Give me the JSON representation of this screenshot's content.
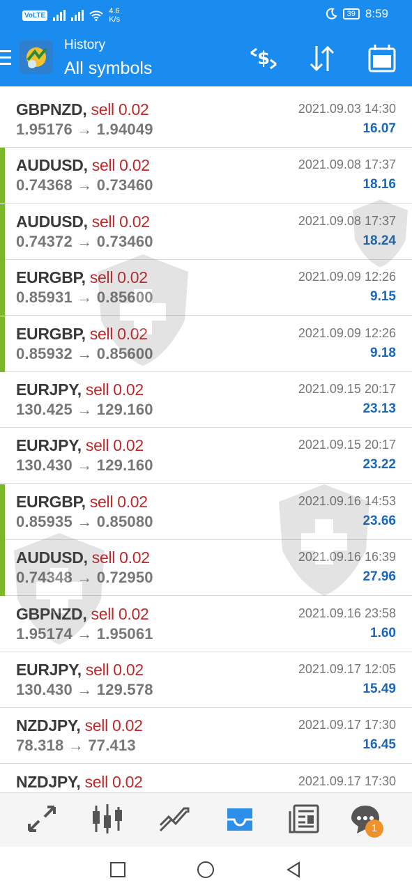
{
  "status_bar": {
    "volte": "VoLTE",
    "speed_value": "4.6",
    "speed_unit": "K/s",
    "battery": "39",
    "time": "8:59"
  },
  "header": {
    "title_small": "History",
    "title_big": "All symbols",
    "menu_icon": "hamburger-icon",
    "toolbar_icons": [
      "currency-exchange-icon",
      "sort-icon",
      "calendar-icon"
    ]
  },
  "colors": {
    "header_bg": "#1a8cf0",
    "sell": "#c0282a",
    "profit": "#1b67b8",
    "indicator_green": "#7ab82a"
  },
  "deals": [
    {
      "symbol": "GBPNZD",
      "order": "sell 0.02",
      "open": "1.95176",
      "close": "1.94049",
      "time": "2021.09.03 14:30",
      "profit": "16.07",
      "marked": false
    },
    {
      "symbol": "AUDUSD",
      "order": "sell 0.02",
      "open": "0.74368",
      "close": "0.73460",
      "time": "2021.09.08 17:37",
      "profit": "18.16",
      "marked": true
    },
    {
      "symbol": "AUDUSD",
      "order": "sell 0.02",
      "open": "0.74372",
      "close": "0.73460",
      "time": "2021.09.08 17:37",
      "profit": "18.24",
      "marked": true
    },
    {
      "symbol": "EURGBP",
      "order": "sell 0.02",
      "open": "0.85931",
      "close": "0.85600",
      "time": "2021.09.09 12:26",
      "profit": "9.15",
      "marked": true
    },
    {
      "symbol": "EURGBP",
      "order": "sell 0.02",
      "open": "0.85932",
      "close": "0.85600",
      "time": "2021.09.09 12:26",
      "profit": "9.18",
      "marked": true
    },
    {
      "symbol": "EURJPY",
      "order": "sell 0.02",
      "open": "130.425",
      "close": "129.160",
      "time": "2021.09.15 20:17",
      "profit": "23.13",
      "marked": false
    },
    {
      "symbol": "EURJPY",
      "order": "sell 0.02",
      "open": "130.430",
      "close": "129.160",
      "time": "2021.09.15 20:17",
      "profit": "23.22",
      "marked": false
    },
    {
      "symbol": "EURGBP",
      "order": "sell 0.02",
      "open": "0.85935",
      "close": "0.85080",
      "time": "2021.09.16 14:53",
      "profit": "23.66",
      "marked": true
    },
    {
      "symbol": "AUDUSD",
      "order": "sell 0.02",
      "open": "0.74348",
      "close": "0.72950",
      "time": "2021.09.16 16:39",
      "profit": "27.96",
      "marked": true
    },
    {
      "symbol": "GBPNZD",
      "order": "sell 0.02",
      "open": "1.95174",
      "close": "1.95061",
      "time": "2021.09.16 23:58",
      "profit": "1.60",
      "marked": false
    },
    {
      "symbol": "EURJPY",
      "order": "sell 0.02",
      "open": "130.430",
      "close": "129.578",
      "time": "2021.09.17 12:05",
      "profit": "15.49",
      "marked": false
    },
    {
      "symbol": "NZDJPY",
      "order": "sell 0.02",
      "open": "78.318",
      "close": "77.413",
      "time": "2021.09.17 17:30",
      "profit": "16.45",
      "marked": false
    },
    {
      "symbol": "NZDJPY",
      "order": "sell 0.02",
      "open": "",
      "close": "",
      "time": "2021.09.17 17:30",
      "profit": "",
      "marked": false
    }
  ],
  "bottom_nav": {
    "items": [
      "quotes-icon",
      "chart-icon",
      "trade-icon",
      "history-icon",
      "news-icon",
      "messages-icon"
    ],
    "active": "history-icon",
    "messages_badge": "1"
  },
  "system_nav": [
    "recents-icon",
    "home-icon",
    "back-icon"
  ]
}
